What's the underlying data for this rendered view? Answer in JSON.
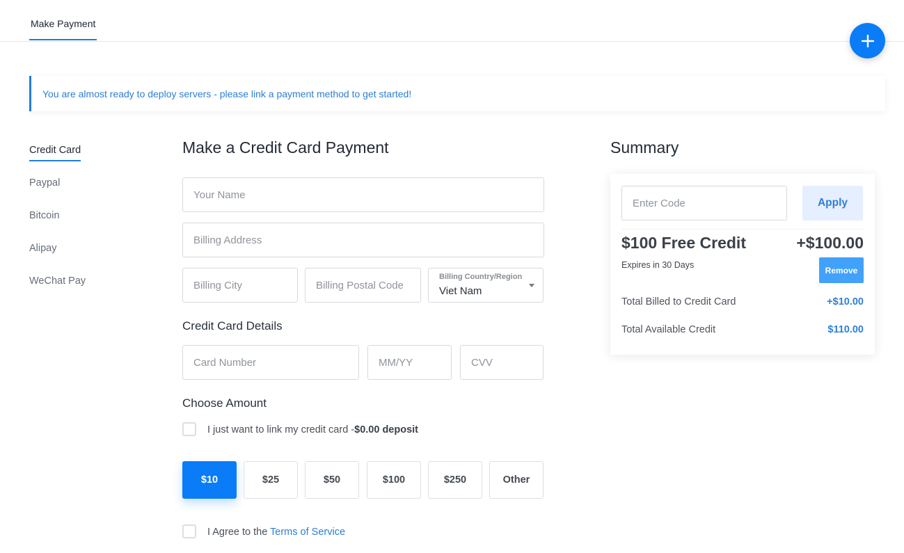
{
  "header": {
    "tab_label": "Make Payment",
    "fab_icon": "plus-icon"
  },
  "alert": {
    "message": "You are almost ready to deploy servers - please link a payment method to get started!"
  },
  "sidebar": {
    "items": [
      {
        "label": "Credit Card",
        "active": true
      },
      {
        "label": "Paypal"
      },
      {
        "label": "Bitcoin"
      },
      {
        "label": "Alipay"
      },
      {
        "label": "WeChat Pay"
      }
    ]
  },
  "form": {
    "title": "Make a Credit Card Payment",
    "name_placeholder": "Your Name",
    "address_placeholder": "Billing Address",
    "city_placeholder": "Billing City",
    "postal_placeholder": "Billing Postal Code",
    "country_label": "Billing Country/Region",
    "country_value": "Viet Nam",
    "card_section_title": "Credit Card Details",
    "card_number_placeholder": "Card Number",
    "expiry_placeholder": "MM/YY",
    "cvv_placeholder": "CVV",
    "amount_section_title": "Choose Amount",
    "link_only_text": "I just want to link my credit card -",
    "link_only_bold": "$0.00 deposit",
    "amounts": [
      "$10",
      "$25",
      "$50",
      "$100",
      "$250",
      "Other"
    ],
    "selected_amount": "$10",
    "agree_text": "I Agree to the ",
    "terms_link": "Terms of Service"
  },
  "summary": {
    "title": "Summary",
    "code_placeholder": "Enter Code",
    "apply_label": "Apply",
    "credit_title": "$100 Free Credit",
    "credit_amount": "+$100.00",
    "expires": "Expires in 30 Days",
    "remove_label": "Remove",
    "billed_label": "Total Billed to Credit Card",
    "billed_value": "+$10.00",
    "available_label": "Total Available Credit",
    "available_value": "$110.00"
  },
  "colors": {
    "accent": "#0a7cf8",
    "link": "#2b7fd4",
    "apply_bg": "#e6efff",
    "remove_bg": "#42a1fa"
  }
}
